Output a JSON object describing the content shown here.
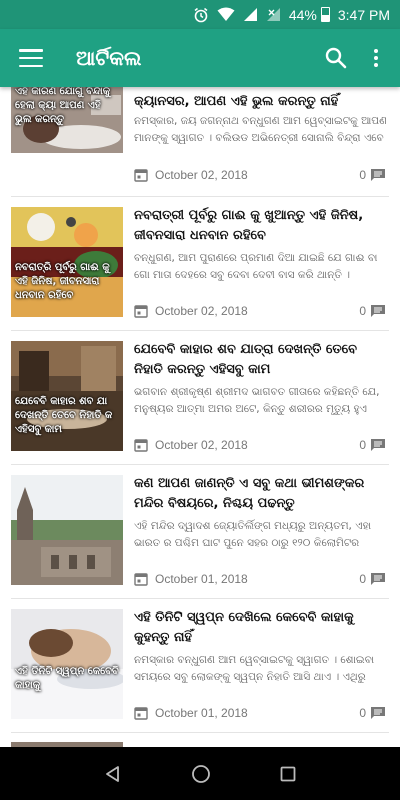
{
  "status_bar": {
    "battery": "44%",
    "time": "3:47 PM"
  },
  "app_bar": {
    "title": "ଆର୍ଟିକଲ"
  },
  "articles": [
    {
      "thumb_caption": "ଏହି କାରଣ ଯୋଗୁ ବିନ୍ଦାକୁ ହେଲା କ୍ୟା ଆପଣ ଏହି ଭୁଲ କରନ୍ତୁ",
      "title": "କ୍ୟାନସର, ଆପଣ ଏହି ଭୁଲ କରନ୍ତୁ ନାହିଁ",
      "excerpt_1": "ନମସ୍କାର, ଜୟ ଜଗନ୍ନାଥ ବନ୍ଧୁଗଣ ଆମ ୱେବ୍‌ସାଇଟକୁ ଆପଣ",
      "excerpt_2": "ମାନଙ୍କୁ ସ୍ୱାଗତ । ବଲିଉଡ ଅଭିନେତ୍ରୀ ସୋନାଲି ବିନ୍ଦ୍ରା ଏବେ",
      "date": "October 02, 2018",
      "comments": "0"
    },
    {
      "thumb_caption": "ନବରାତ୍ରି ପୂର୍ବରୁ ଗାଈ କୁ ଏହି ଜିନିଷ, ଜୀବନସାରା ଧନବାନ ରହିବେ",
      "title": "ନବରାତ୍ରୀ ପୂର୍ବରୁ ଗାଈ କୁ ଖୁଆନ୍ତୁ ଏହି ଜିନିଷ, ଜୀବନସାରା ଧନବାନ ରହିବେ",
      "excerpt_1": "ବନ୍ଧୁଗଣ, ଆମ ପୁରାଣରେ ପ୍ରମାଣ ଦିଆ ଯାଇଛି ଯେ ଗାଈ ବା",
      "excerpt_2": "ଗୋ ମାତା ଦେହରେ ସବୁ ଦେବା ଦେବୀ ବାସ କରି ଥାନ୍ତି ।",
      "date": "October 02, 2018",
      "comments": "0"
    },
    {
      "thumb_caption": "ଯେବେବି କାହାର ଶବ ଯା ଦେଖନ୍ତି ତେବେ ନିହାତି କ ଏହିସବୁ କାମ",
      "title": "ଯେବେବି କାହାର ଶବ ଯାତ୍ରା ଦେଖନ୍ତି ତେବେ ନିହାତି କରନ୍ତୁ ଏହିସବୁ କାମ",
      "excerpt_1": "ଭଗବାନ ଶ୍ରୀକୃଷ୍ଣ ଶ୍ରୀମଦ ଭାଗବତ ଗୀତାରେ କହିଛନ୍ତି ଯେ,",
      "excerpt_2": "ମନୁଷ୍ୟର ଆତ୍ମା ଅମର ଅଟେ, କିନ୍ତୁ ଶରୀରର ମୃତ୍ୟୁ ହୁଏ",
      "date": "October 02, 2018",
      "comments": "0"
    },
    {
      "thumb_caption": "",
      "title": "କଣ ଆପଣ ଜାଣନ୍ତି ଏ ସବୁ କଥା ଭୀମଶଙ୍କର ମନ୍ଦିର ବିଷୟରେ, ନିଶ୍ଚୟ ପଢନ୍ତୁ",
      "excerpt_1": "ଏହି ମନ୍ଦିର ଦ୍ୱାଦଶ ଜ୍ୟୋତିର୍ଲିଙ୍ଗ ମଧ୍ୟରୁ ଅନ୍ୟତମ, ଏହା",
      "excerpt_2": "ଭାରତ ର ପଶ୍ଚିମ ଘାଟ ପୁନେ ସହର ଠାରୁ ୧୨୦ କିଲୋମିଟର",
      "date": "October 01, 2018",
      "comments": "0"
    },
    {
      "thumb_caption": "ଏହି ତିନିଟି ସ୍ୱପ୍ନ କେବେବି କାହାକୁ",
      "title": "ଏହି ତିନିଟି ସ୍ୱପ୍ନ ଦେଖିଲେ କେବେବି କାହାକୁ କୁହନ୍ତୁ ନାହିଁ",
      "excerpt_1": "ନମସ୍କାର ବନ୍ଧୁଗଣ ଆମ ୱେବ୍‌ସାଇଟକୁ ସ୍ୱାଗତ । ଶୋଇବା",
      "excerpt_2": "ସମୟରେ ସବୁ ଲୋକଙ୍କୁ ସ୍ୱପ୍ନ ନିହାତି ଆସି ଥାଏ । ଏଥିରୁ",
      "date": "October 01, 2018",
      "comments": "0"
    }
  ],
  "icons": {
    "menu": "hamburger-icon",
    "search": "search-icon",
    "more": "more-vert-icon",
    "calendar": "calendar-icon",
    "comment": "comment-icon",
    "back": "back-icon",
    "home": "home-icon",
    "recents": "recents-icon"
  },
  "colors": {
    "status_bar": "#1f9477",
    "app_bar": "#1fa183"
  }
}
